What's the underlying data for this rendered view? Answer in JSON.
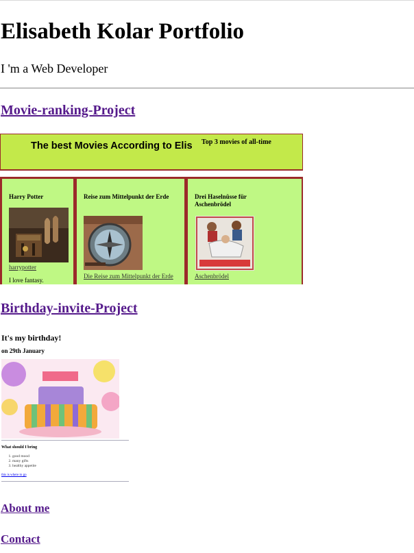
{
  "page": {
    "title": "Elisabeth Kolar Portfolio",
    "subtitle": "I 'm a Web Developer"
  },
  "sections": {
    "movie": {
      "label": "Movie-ranking-Project"
    },
    "birthday": {
      "label": "Birthday-invite-Project"
    },
    "about": {
      "label": "About me"
    },
    "contact": {
      "label": "Contact"
    }
  },
  "movie_preview": {
    "title": "The best Movies According to Elis",
    "sup": "Top 3 movies of all-time",
    "cards": [
      {
        "title": "Harry Potter",
        "caption": "harrypotter",
        "text": "I love fantasy."
      },
      {
        "title": "Reise zum Mittelpunkt der Erde",
        "caption": "Die Reise zum Mittelpunkt der Erde",
        "text": ""
      },
      {
        "title": "Drei Haselnüsse für Aschenbrödel",
        "caption": "Aschenbrödel",
        "text": ""
      }
    ],
    "colors": {
      "card_bg": "#bff884",
      "header_bg": "#c3e94a",
      "border": "#9b2a2a"
    }
  },
  "birthday_preview": {
    "heading": "It's my birthday!",
    "date": "on 29th January",
    "question": "What should I bring",
    "items": [
      "good mood",
      "many gifts",
      "healthy appetite"
    ],
    "link": "this is where to go"
  },
  "colors": {
    "visited_link": "#551a8b",
    "link": "#0000ee"
  }
}
